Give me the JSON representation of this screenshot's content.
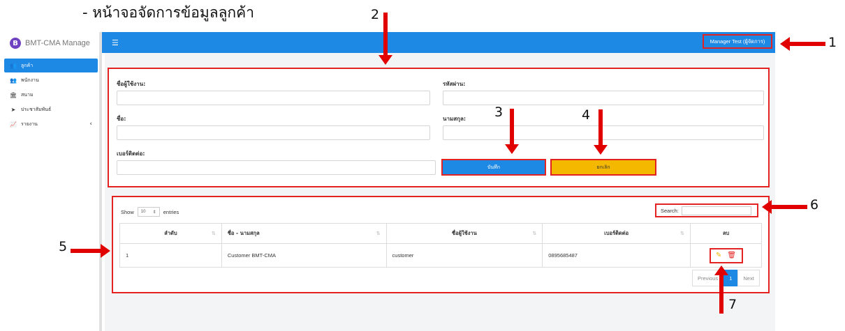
{
  "page_heading": "- หน้าจอจัดการข้อมูลลูกค้า",
  "brand": {
    "logo_letter": "B",
    "name": "BMT-CMA Manage"
  },
  "sidebar": {
    "items": [
      {
        "label": "ลูกค้า",
        "icon": "users-icon",
        "active": true
      },
      {
        "label": "พนักงาน",
        "icon": "user-group-icon",
        "active": false
      },
      {
        "label": "สนาม",
        "icon": "building-icon",
        "active": false
      },
      {
        "label": "ประชาสัมพันธ์",
        "icon": "paper-plane-icon",
        "active": false
      },
      {
        "label": "รายงาน",
        "icon": "chart-line-icon",
        "active": false,
        "chevron": "‹"
      }
    ]
  },
  "topbar": {
    "menu_icon": "hamburger-icon",
    "user": "Manager Test (ผู้จัดการ)"
  },
  "form": {
    "username_label": "ชื่อผู้ใช้งาน:",
    "password_label": "รหัสผ่าน:",
    "firstname_label": "ชื่อ:",
    "lastname_label": "นามสกุล:",
    "phone_label": "เบอร์ติดต่อ:",
    "save_label": "บันทึก",
    "cancel_label": "ยกเลิก"
  },
  "table": {
    "show_label": "Show",
    "entries_label": "entries",
    "page_length": "10",
    "search_label": "Search:",
    "headers": [
      "ลำดับ",
      "ชื่อ - นามสกุล",
      "ชื่อผู้ใช้งาน",
      "เบอร์ติดต่อ",
      "ลบ"
    ],
    "rows": [
      {
        "no": "1",
        "name": "Customer BMT-CMA",
        "username": "customer",
        "phone": "0895685487"
      }
    ],
    "pager": {
      "previous": "Previous",
      "current": "1",
      "next": "Next"
    }
  },
  "callouts": [
    "1",
    "2",
    "3",
    "4",
    "5",
    "6",
    "7"
  ],
  "colors": {
    "primary": "#1e88e5",
    "warning": "#f5b800",
    "highlight": "#e52222"
  }
}
